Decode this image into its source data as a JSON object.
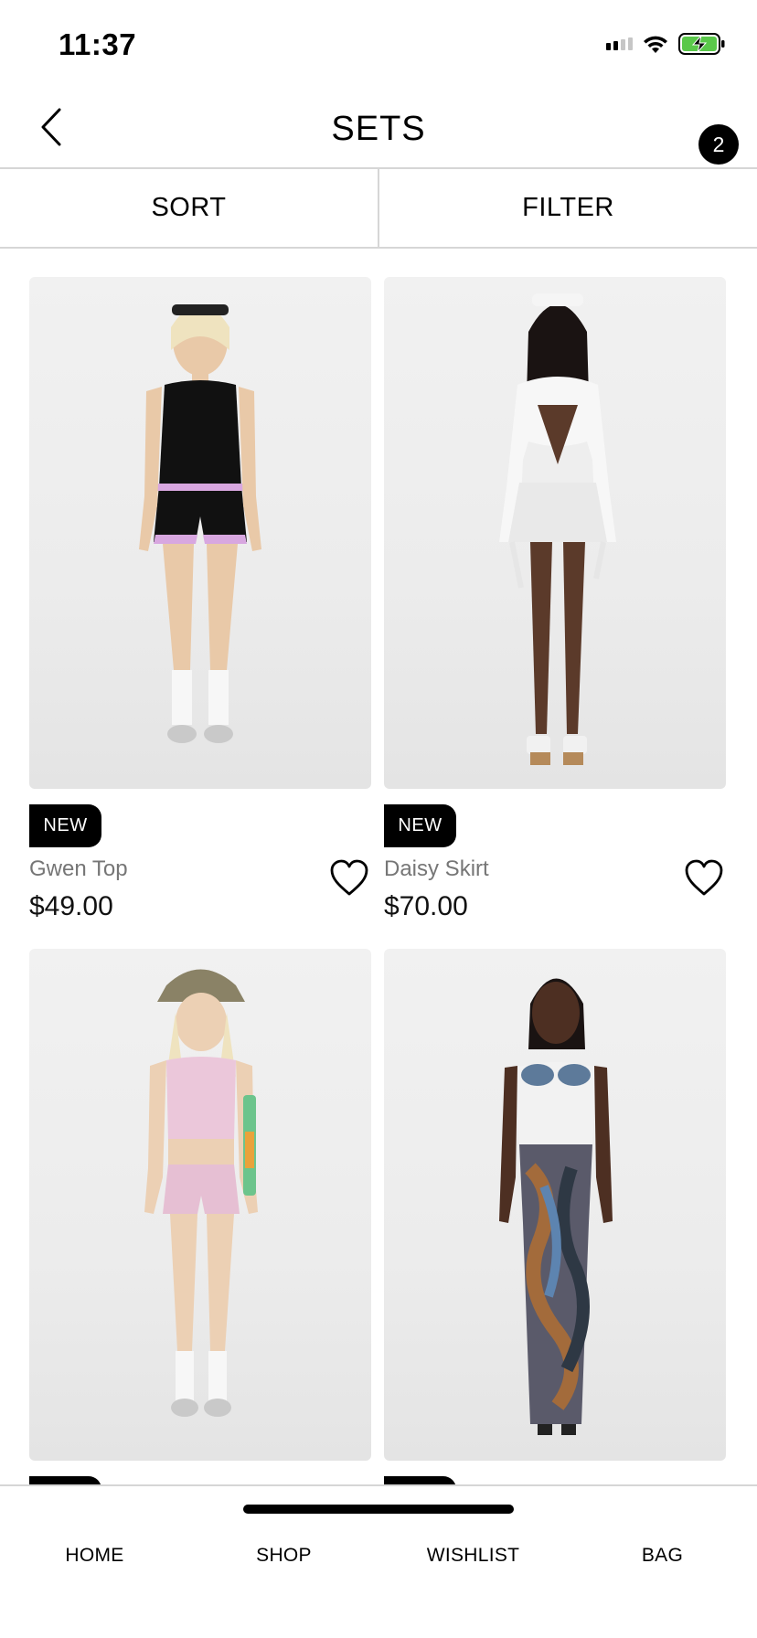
{
  "status_bar": {
    "time": "11:37"
  },
  "header": {
    "title": "SETS",
    "count_badge": "2"
  },
  "toolbar": {
    "sort_label": "SORT",
    "filter_label": "FILTER"
  },
  "products": [
    {
      "name": "Gwen Top",
      "price": "$49.00",
      "badge": "NEW",
      "outfit_colors": [
        "#111111",
        "#d8a7e0"
      ]
    },
    {
      "name": "Daisy Skirt",
      "price": "$70.00",
      "badge": "NEW",
      "outfit_colors": [
        "#f7f7f7",
        "#e9e9e9"
      ]
    },
    {
      "name": "",
      "price": "",
      "badge": "",
      "outfit_colors": [
        "#ebc7da",
        "#e6bfd3"
      ]
    },
    {
      "name": "",
      "price": "",
      "badge": "",
      "outfit_colors": [
        "#f2f2f2",
        "#5a5a6a"
      ]
    }
  ],
  "bottom_nav": {
    "items": [
      "HOME",
      "SHOP",
      "WISHLIST",
      "BAG"
    ]
  },
  "colors": {
    "accent": "#000000",
    "divider": "#d6d6d6",
    "muted_text": "#767676",
    "battery": "#5ac84a"
  }
}
